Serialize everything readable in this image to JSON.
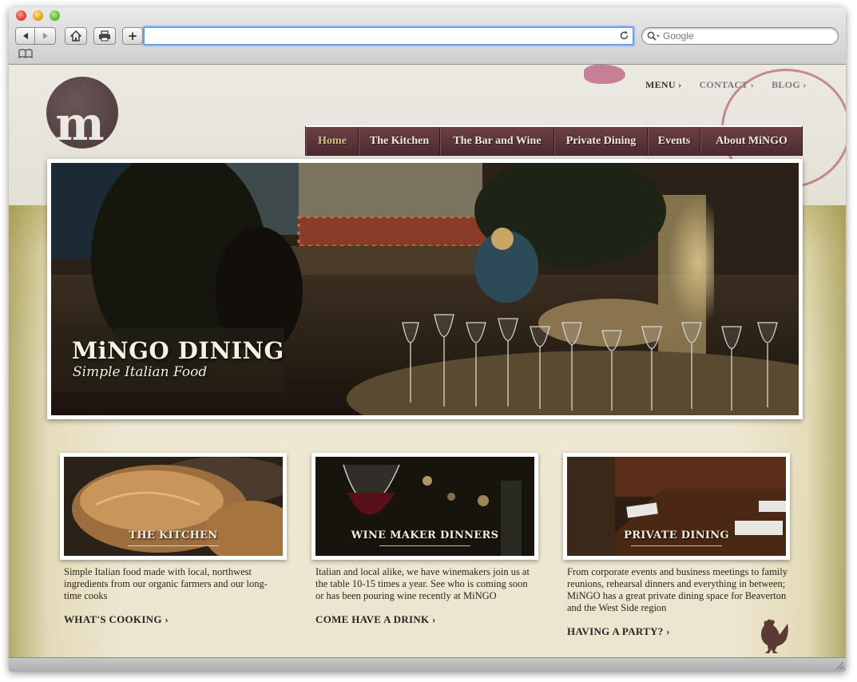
{
  "browser": {
    "url_value": "",
    "search_placeholder": "Google",
    "buttons": {
      "back": "back-arrow",
      "forward": "forward-arrow",
      "home": "home-icon",
      "print": "printer-icon",
      "add": "+"
    }
  },
  "site": {
    "logo_letter": "m",
    "utility_nav": [
      {
        "label": "MENU ›"
      },
      {
        "label": "CONTACT ›"
      },
      {
        "label": "BLOG ›"
      }
    ],
    "main_nav": [
      {
        "label": "Home",
        "active": true
      },
      {
        "label": "The Kitchen"
      },
      {
        "label": "The Bar and Wine"
      },
      {
        "label": "Private Dining"
      },
      {
        "label": "Events"
      },
      {
        "label": "About MiNGO"
      }
    ],
    "hero": {
      "title": "MiNGO DINING",
      "subtitle": "Simple Italian Food"
    },
    "features": [
      {
        "label": "THE KITCHEN",
        "text": "Simple Italian food made with local, northwest ingredients from our organic farmers and our long-time cooks",
        "link": "WHAT'S COOKING ›"
      },
      {
        "label": "WINE MAKER DINNERS",
        "text": "Italian and local alike, we have winemakers join us at the table 10-15 times a year. See who is coming soon or has been pouring wine recently at MiNGO",
        "link": "COME HAVE A DRINK ›"
      },
      {
        "label": "PRIVATE DINING",
        "text": "From corporate events and business meetings to family reunions, rehearsal dinners and everything in between; MiNGO has a great private dining space for Beaverton and the West Side region",
        "link": "HAVING A PARTY? ›"
      }
    ]
  },
  "colors": {
    "nav_bg": "#5a3337",
    "nav_active": "#d6c48a",
    "logo_bg": "#4a3838",
    "band_olive": "#c7be86",
    "text_dark": "#2d2420"
  }
}
